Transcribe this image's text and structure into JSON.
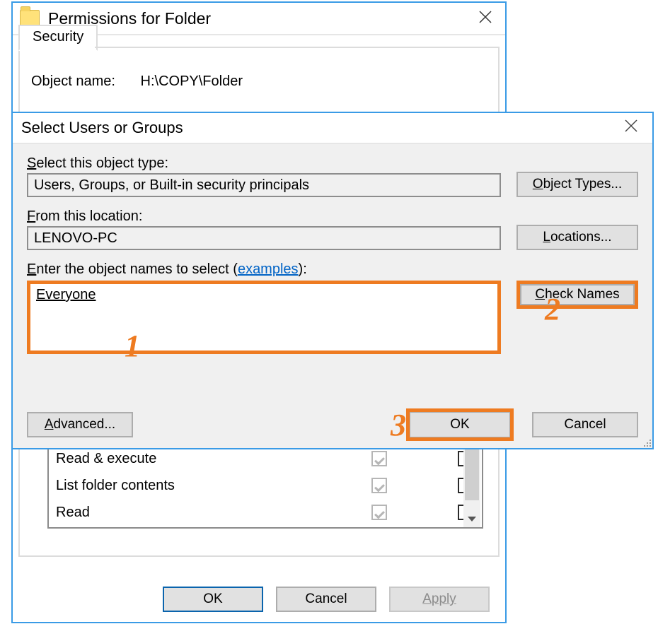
{
  "backWindow": {
    "title": "Permissions for Folder",
    "tab": "Security",
    "objectNameLabel": "Object name:",
    "objectName": "H:\\COPY\\Folder",
    "perms": [
      {
        "label": "Read & execute"
      },
      {
        "label": "List folder contents"
      },
      {
        "label": "Read"
      }
    ],
    "buttons": {
      "ok": "OK",
      "cancel": "Cancel",
      "apply": "Apply"
    }
  },
  "frontWindow": {
    "title": "Select Users or Groups",
    "objTypeLabel": {
      "pre": "S",
      "rest": "elect this object type:"
    },
    "objType": "Users, Groups, or Built-in security principals",
    "objectTypesBtn": {
      "pre": "O",
      "rest": "bject Types..."
    },
    "locLabel": {
      "pre": "F",
      "rest": "rom this location:"
    },
    "location": "LENOVO-PC",
    "locationsBtn": {
      "pre": "L",
      "rest": "ocations..."
    },
    "enterLabel": {
      "pre": "E",
      "rest": "nter the object names to select ("
    },
    "examplesLink": {
      "pre": "e",
      "rest": "xamples"
    },
    "enterLabelTail": "):",
    "objectNames": "Everyone",
    "checkNamesBtn": {
      "pre": "C",
      "rest": "heck Names"
    },
    "advancedBtn": {
      "pre": "A",
      "rest": "dvanced..."
    },
    "ok": "OK",
    "cancel": "Cancel"
  },
  "annotations": {
    "n1": "1",
    "n2": "2",
    "n3": "3"
  }
}
